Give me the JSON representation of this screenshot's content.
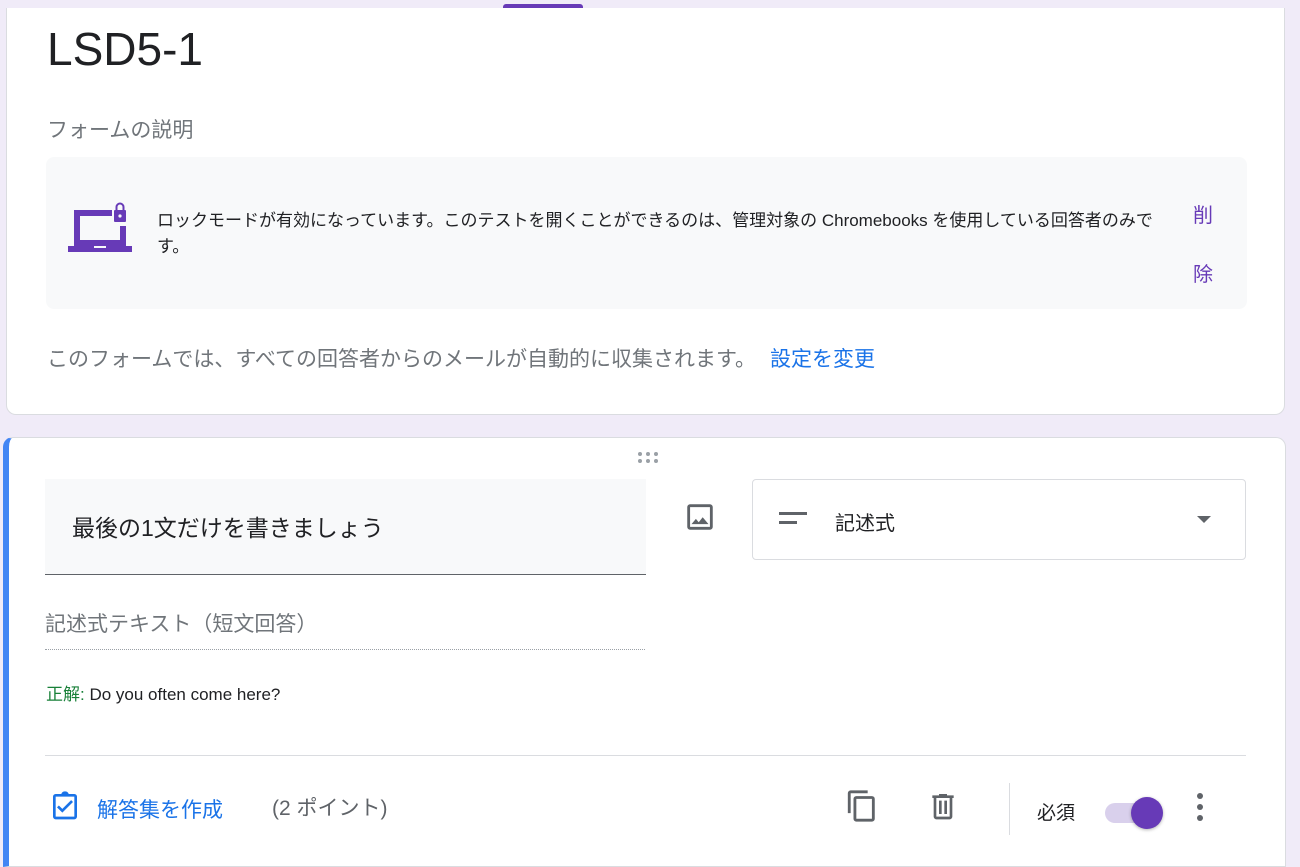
{
  "form": {
    "title": "LSD5-1",
    "description_placeholder": "フォームの説明"
  },
  "lock_mode": {
    "message": "ロックモードが有効になっています。このテストを開くことができるのは、管理対象の Chromebooks を使用している回答者のみです。",
    "remove_label": "削除"
  },
  "email_notice": {
    "text": "このフォームでは、すべての回答者からのメールが自動的に収集されます。",
    "link": "設定を変更"
  },
  "question": {
    "title": "最後の1文だけを書きましょう",
    "type": "記述式",
    "answer_placeholder": "記述式テキスト（短文回答）",
    "correct_label": "正解:",
    "correct_answer": " Do you often come here?",
    "answer_key_label": "解答集を作成",
    "points": "(2 ポイント)",
    "required_label": "必須",
    "required": true
  },
  "colors": {
    "accent": "#673ab7",
    "link": "#1a73e8",
    "active_border": "#4285f4",
    "correct": "#188038"
  }
}
